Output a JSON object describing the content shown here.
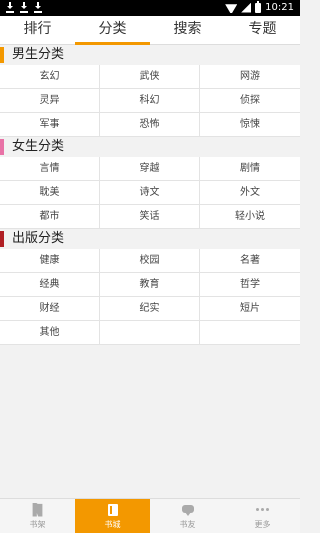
{
  "status": {
    "time": "10:21"
  },
  "tabs": [
    "排行",
    "分类",
    "搜索",
    "专题"
  ],
  "sections": [
    {
      "title": "男生分类",
      "color": "#f39800",
      "items": [
        "玄幻",
        "武侠",
        "网游",
        "灵异",
        "科幻",
        "侦探",
        "军事",
        "恐怖",
        "惊悚"
      ]
    },
    {
      "title": "女生分类",
      "color": "#e872a6",
      "items": [
        "言情",
        "穿越",
        "剧情",
        "耽美",
        "诗文",
        "外文",
        "都市",
        "笑话",
        "轻小说"
      ]
    },
    {
      "title": "出版分类",
      "color": "#b01e23",
      "items": [
        "健康",
        "校园",
        "名著",
        "经典",
        "教育",
        "哲学",
        "财经",
        "纪实",
        "短片",
        "其他",
        "",
        ""
      ]
    }
  ],
  "bottom_nav": [
    {
      "label": "书架",
      "icon": "bookshelf-icon"
    },
    {
      "label": "书城",
      "icon": "bookstore-icon"
    },
    {
      "label": "书友",
      "icon": "friends-icon"
    },
    {
      "label": "更多",
      "icon": "more-icon"
    }
  ]
}
